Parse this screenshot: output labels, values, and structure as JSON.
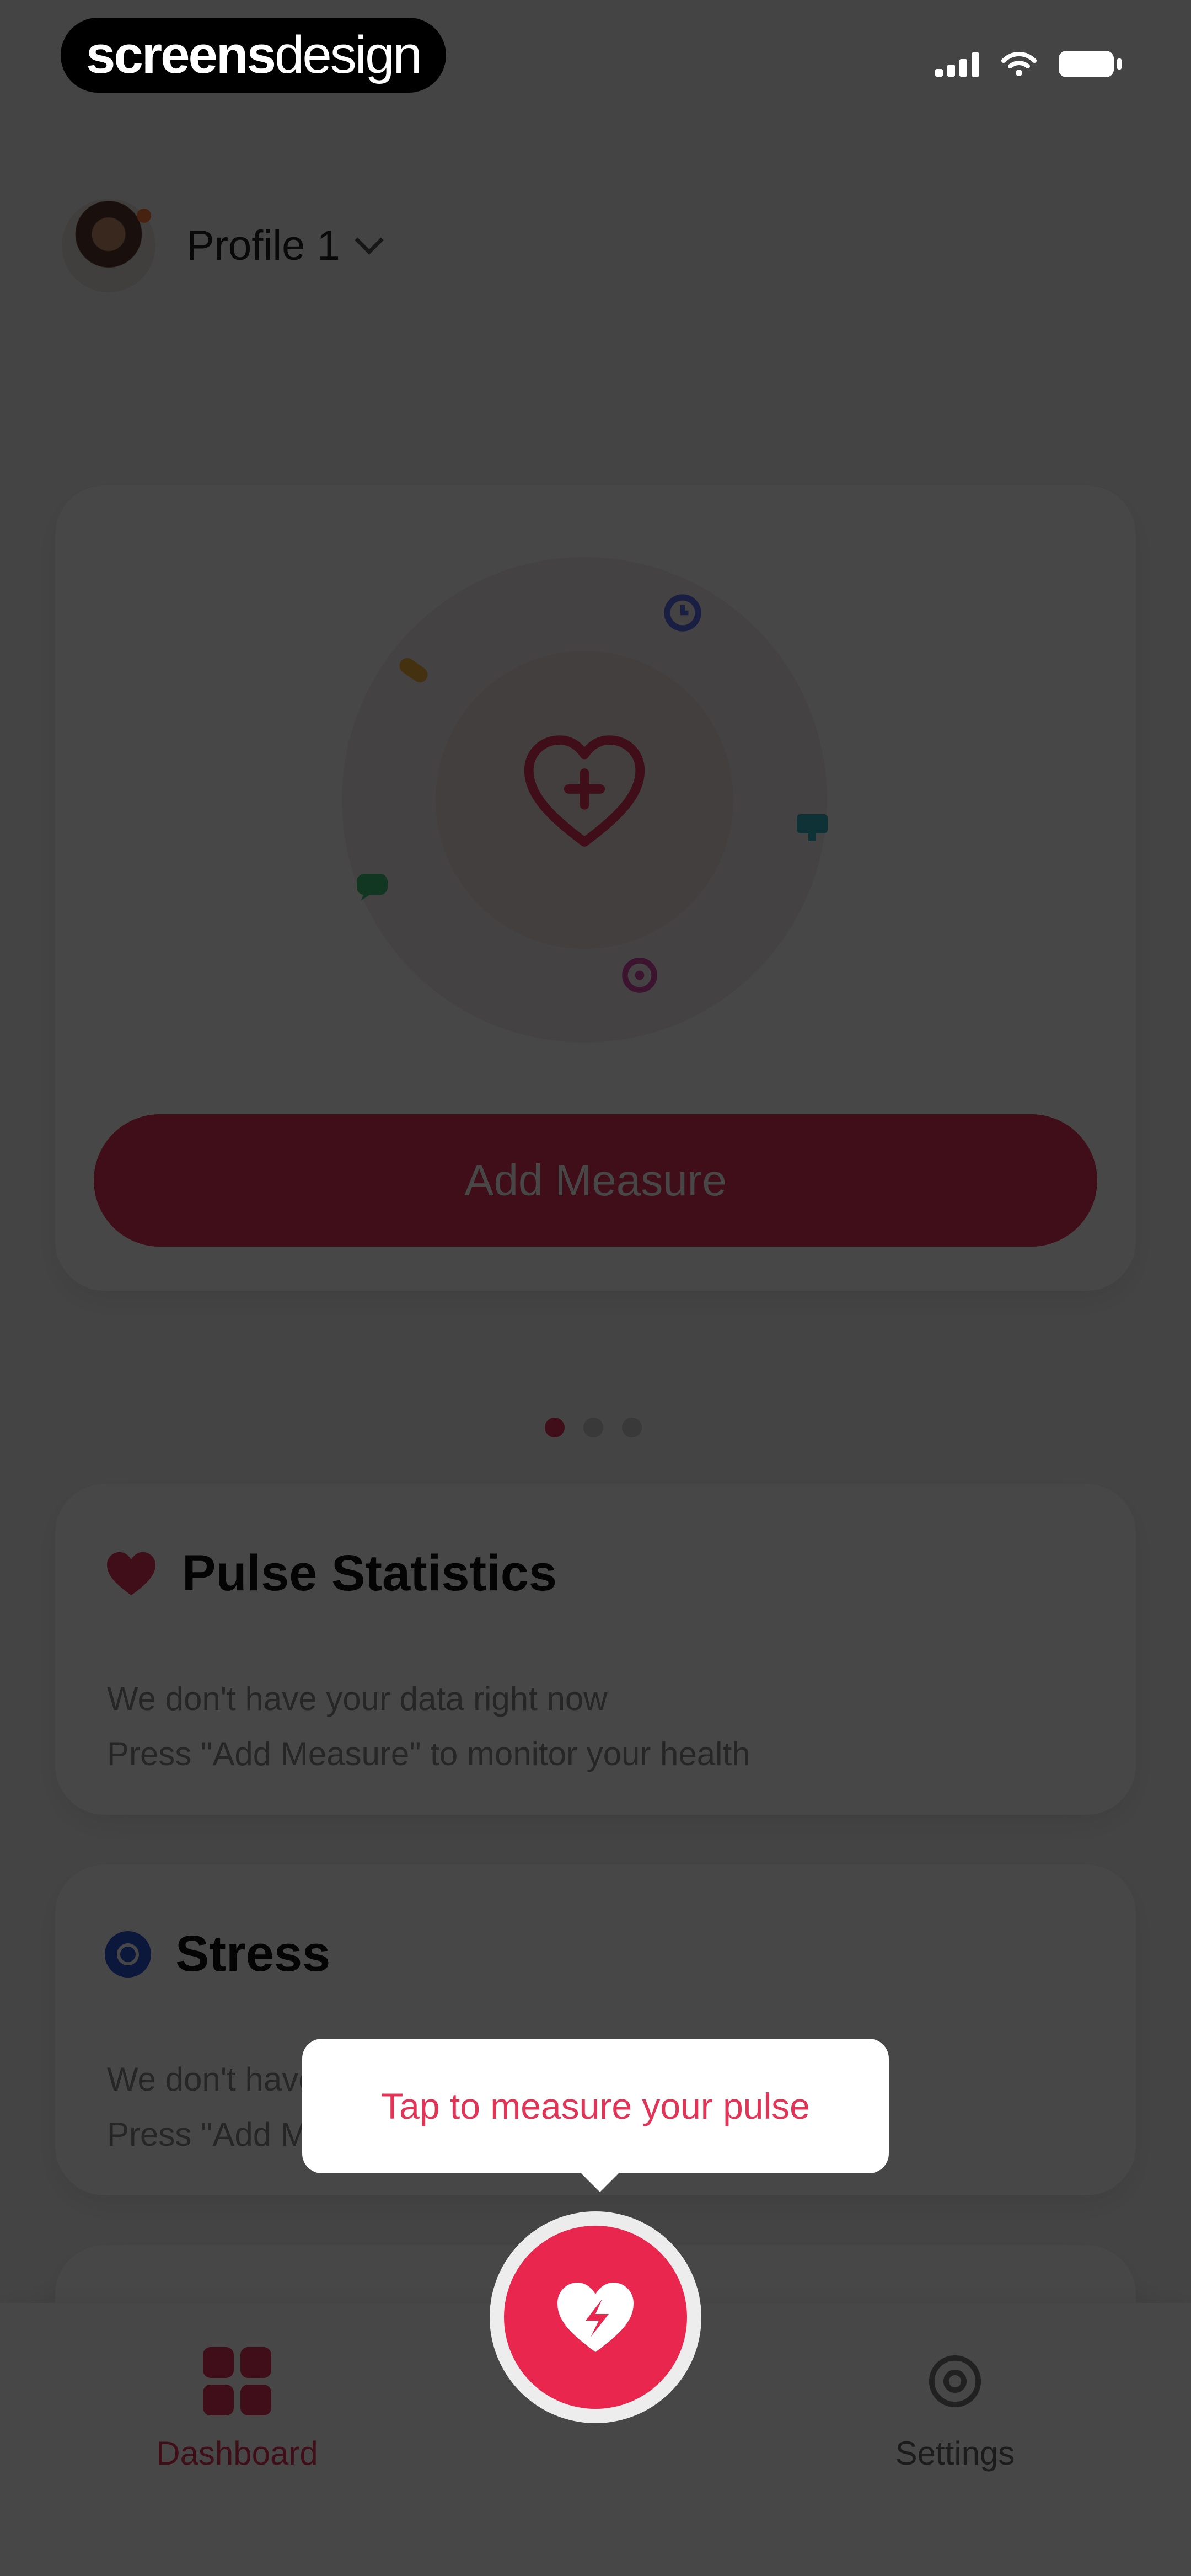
{
  "status_bar": {
    "brand_bold": "screens",
    "brand_light": "design"
  },
  "profile": {
    "name": "Profile 1"
  },
  "measure_card": {
    "button_label": "Add Measure",
    "center_icon": "heart-plus-icon",
    "orbit_icons": [
      "pill-icon",
      "clock-icon",
      "monitor-icon",
      "chat-icon",
      "flower-icon"
    ]
  },
  "pager": {
    "count": 3,
    "active_index": 0
  },
  "pulse_card": {
    "title": "Pulse Statistics",
    "line1": "We don't have your data right now",
    "line2": "Press \"Add Measure\" to monitor your health"
  },
  "stress_card": {
    "title": "Stress",
    "line1": "We don't have your data right now",
    "line2": "Press \"Add Measure\" to monitor your health"
  },
  "tooltip": {
    "text": "Tap to measure your pulse"
  },
  "tabbar": {
    "dashboard_label": "Dashboard",
    "settings_label": "Settings",
    "fab_icon": "heart-pulse-icon"
  },
  "colors": {
    "accent": "#e23457",
    "stress": "#2b55d8",
    "overlay": "#000000"
  }
}
